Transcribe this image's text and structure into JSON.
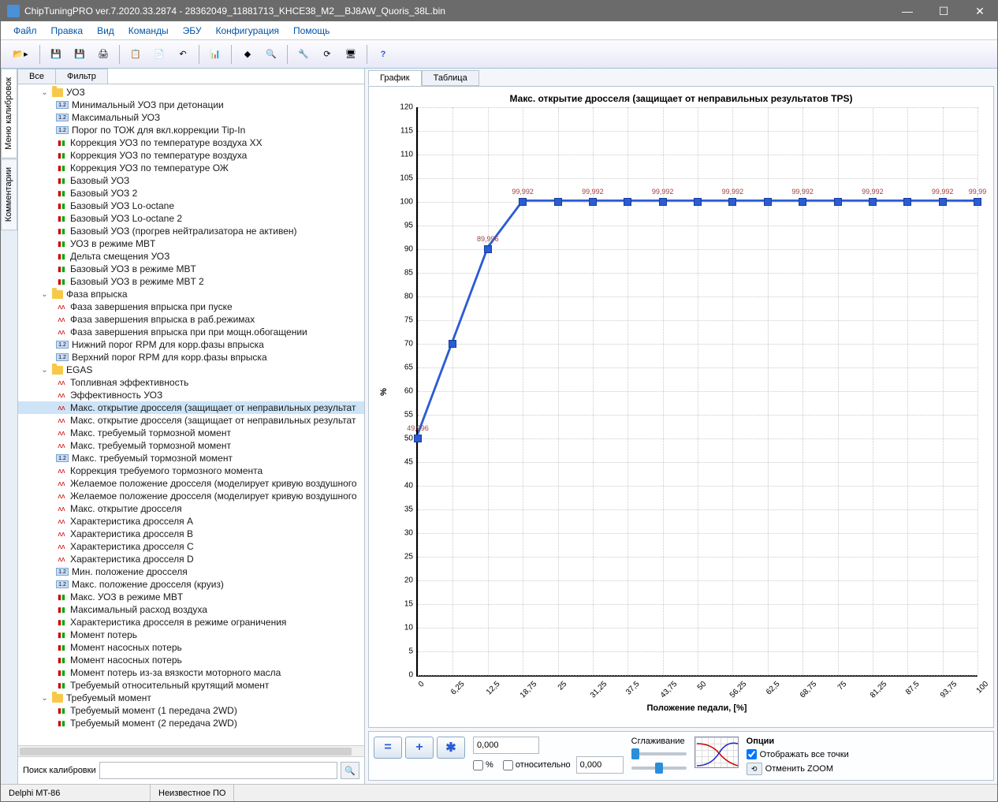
{
  "window": {
    "title": "ChipTuningPRO ver.7.2020.33.2874 - 28362049_11881713_KHCE38_M2__BJ8AW_Quoris_38L.bin"
  },
  "menu": [
    "Файл",
    "Правка",
    "Вид",
    "Команды",
    "ЭБУ",
    "Конфигурация",
    "Помощь"
  ],
  "side_tabs": {
    "a": "Меню калибровок",
    "b": "Комментарии"
  },
  "filter_tabs": {
    "all": "Все",
    "filter": "Фильтр"
  },
  "search": {
    "label": "Поиск калибровки"
  },
  "tree": {
    "f1": "УОЗ",
    "f1_items": [
      "Минимальный УОЗ при детонации",
      "Максимальный УОЗ",
      "Порог по ТОЖ для вкл.коррекции Tip-In",
      "Коррекция УОЗ по температуре воздуха XX",
      "Коррекция УОЗ по температуре воздуха",
      "Коррекция УОЗ по температуре ОЖ",
      "Базовый УОЗ",
      "Базовый УОЗ 2",
      "Базовый УОЗ Lo-octane",
      "Базовый УОЗ Lo-octane 2",
      "Базовый УОЗ (прогрев нейтрализатора не активен)",
      "УОЗ в режиме MBT",
      "Дельта смещения УОЗ",
      "Базовый УОЗ в режиме MBT",
      "Базовый УОЗ в режиме MBT 2"
    ],
    "f2": "Фаза впрыска",
    "f2_items": [
      "Фаза завершения впрыска при пуске",
      "Фаза завершения впрыска в раб.режимах",
      "Фаза завершения впрыска при при мощн.обогащении",
      "Нижний порог RPM для корр.фазы впрыска",
      "Верхний порог RPM для корр.фазы впрыска"
    ],
    "f3": "EGAS",
    "f3_items": [
      "Топливная эффективность",
      "Эффективность УОЗ",
      "Макс. открытие дросселя (защищает от неправильных результат",
      "Макс. открытие дросселя (защищает от неправильных результат",
      "Макс. требуемый тормозной момент",
      "Макс. требуемый тормозной момент",
      "Макс. требуемый тормозной момент",
      "Коррекция требуемого тормозного момента",
      "Желаемое положение дросселя (моделирует кривую воздушного",
      "Желаемое положение дросселя (моделирует кривую воздушного",
      "Макс. открытие дросселя",
      "Характеристика дросселя A",
      "Характеристика дросселя B",
      "Характеристика дросселя C",
      "Характеристика дросселя D",
      "Мин. положение дросселя",
      "Макс. положение дросселя (круиз)",
      "Макс. УОЗ в режиме MBT",
      "Максимальный расход воздуха",
      "Характеристика дросселя в режиме ограничения",
      "Момент потерь",
      "Момент насосных потерь",
      "Момент насосных потерь",
      "Момент потерь из-за вязкости моторного масла",
      "Требуемый относительный крутящий момент"
    ],
    "f4": "Требуемый момент",
    "f4_items": [
      "Требуемый момент (1 передача 2WD)",
      "Требуемый момент (2 передача 2WD)"
    ]
  },
  "icon_types": {
    "f1": [
      "box",
      "box",
      "box",
      "rg",
      "rg",
      "rg",
      "rg",
      "rg",
      "rg",
      "rg",
      "rg",
      "rg",
      "rg",
      "rg",
      "rg"
    ],
    "f2": [
      "r",
      "r",
      "r",
      "box",
      "box"
    ],
    "f3": [
      "r",
      "r",
      "r",
      "r",
      "r",
      "r",
      "box",
      "r",
      "r",
      "r",
      "r",
      "r",
      "r",
      "r",
      "r",
      "box",
      "box",
      "rg",
      "rg",
      "rg",
      "rg",
      "rg",
      "rg",
      "rg",
      "rg"
    ],
    "f4": [
      "rg",
      "rg"
    ]
  },
  "selected_item": 2,
  "chart_tabs": {
    "graph": "График",
    "table": "Таблица"
  },
  "chart_data": {
    "type": "line",
    "title": "Макс. открытие дросселя (защищает от неправильных результатов TPS)",
    "xlabel": "Положение педали, [%]",
    "ylabel": "%",
    "x": [
      0,
      6.25,
      12.5,
      18.75,
      25,
      31.25,
      37.5,
      43.75,
      50,
      56.25,
      62.5,
      68.75,
      75,
      81.25,
      87.5,
      93.75,
      100
    ],
    "values": [
      49.996,
      70.0,
      89.996,
      99.992,
      99.992,
      99.992,
      99.992,
      99.992,
      99.992,
      99.992,
      99.992,
      99.992,
      99.992,
      99.992,
      99.992,
      99.992,
      99.99
    ],
    "labels": [
      "49,996",
      "",
      "89,996",
      "99,992",
      "",
      "99,992",
      "",
      "99,992",
      "",
      "99,992",
      "",
      "99,992",
      "",
      "99,992",
      "",
      "99,992",
      "99,99"
    ],
    "xticks": [
      "0",
      "6,25",
      "12,5",
      "18,75",
      "25",
      "31,25",
      "37,5",
      "43,75",
      "50",
      "56,25",
      "62,5",
      "68,75",
      "75",
      "81,25",
      "87,5",
      "93,75",
      "100"
    ],
    "yticks": [
      0,
      5,
      10,
      15,
      20,
      25,
      30,
      35,
      40,
      45,
      50,
      55,
      60,
      65,
      70,
      75,
      80,
      85,
      90,
      95,
      100,
      105,
      110,
      115,
      120
    ],
    "ylim": [
      0,
      120
    ]
  },
  "controls": {
    "val1": "0,000",
    "val2": "0,000",
    "percent": "%",
    "relative": "относительно",
    "smooth": "Сглаживание",
    "options": "Опции",
    "show_all": "Отображать все точки",
    "reset_zoom": "Отменить ZOOM"
  },
  "status": {
    "a": "Delphi MT-86",
    "b": "Неизвестное ПО"
  }
}
